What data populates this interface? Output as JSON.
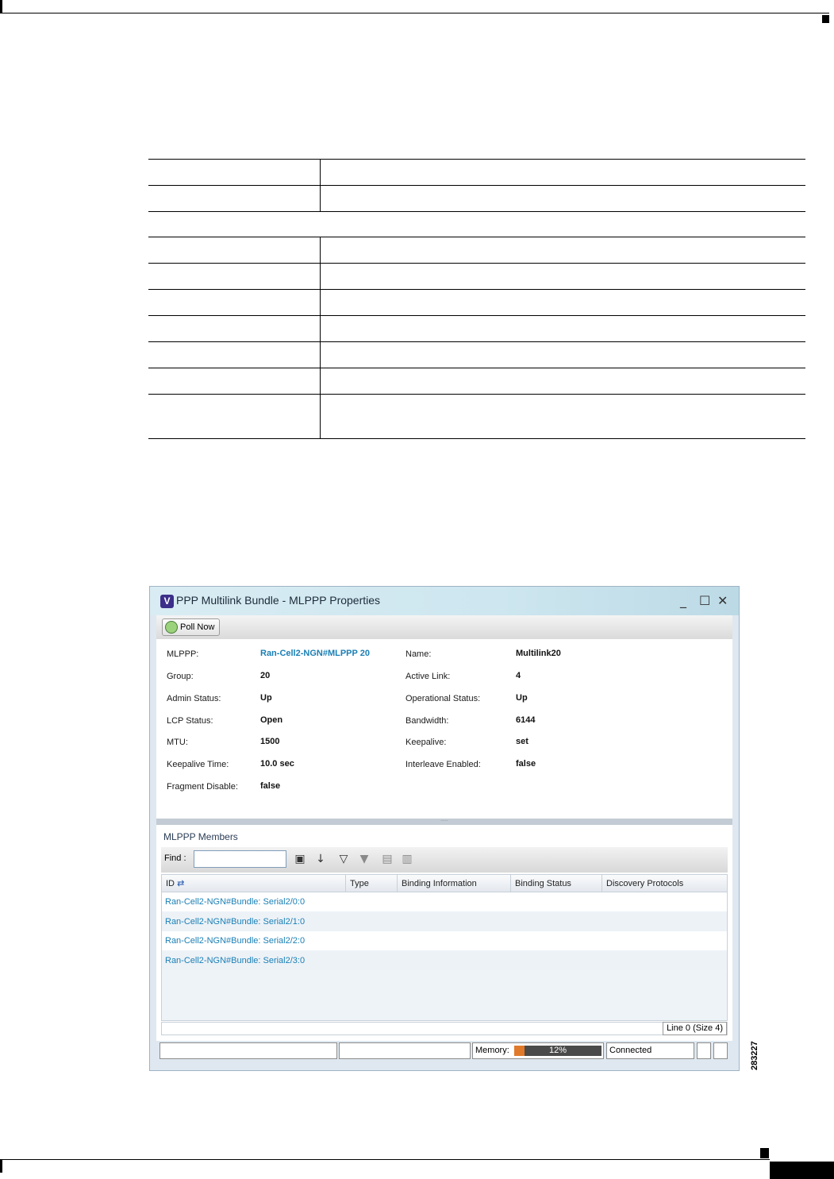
{
  "window": {
    "logo_letter": "V",
    "title": "PPP Multilink Bundle - MLPPP Properties",
    "controls": {
      "minimize": "_",
      "maximize": "☐",
      "close": "✕"
    },
    "poll_button": "Poll Now"
  },
  "properties": {
    "left": [
      {
        "label": "MLPPP:",
        "value": "Ran-Cell2-NGN#MLPPP 20"
      },
      {
        "label": "Group:",
        "value": "20"
      },
      {
        "label": "Admin Status:",
        "value": "Up"
      },
      {
        "label": "LCP Status:",
        "value": "Open"
      },
      {
        "label": "MTU:",
        "value": "1500"
      },
      {
        "label": "Keepalive Time:",
        "value": "10.0 sec"
      },
      {
        "label": "Fragment Disable:",
        "value": "false"
      }
    ],
    "right": [
      {
        "label": "Name:",
        "value": "Multilink20"
      },
      {
        "label": "Active Link:",
        "value": "4"
      },
      {
        "label": "Operational Status:",
        "value": "Up"
      },
      {
        "label": "Bandwidth:",
        "value": "6144"
      },
      {
        "label": "Keepalive:",
        "value": "set"
      },
      {
        "label": "Interleave Enabled:",
        "value": "false"
      }
    ]
  },
  "members": {
    "title": "MLPPP Members",
    "find_label": "Find :",
    "find_value": "",
    "columns": [
      "ID",
      "Type",
      "Binding Information",
      "Binding Status",
      "Discovery Protocols"
    ],
    "rows": [
      "Ran-Cell2-NGN#Bundle: Serial2/0:0",
      "Ran-Cell2-NGN#Bundle: Serial2/1:0",
      "Ran-Cell2-NGN#Bundle: Serial2/2:0",
      "Ran-Cell2-NGN#Bundle: Serial2/3:0"
    ],
    "line_info": "Line 0 (Size 4)"
  },
  "statusbar": {
    "memory_label": "Memory:",
    "memory_percent_text": "12%",
    "memory_fraction": 0.12,
    "connection": "Connected"
  },
  "figure_id": "283227"
}
